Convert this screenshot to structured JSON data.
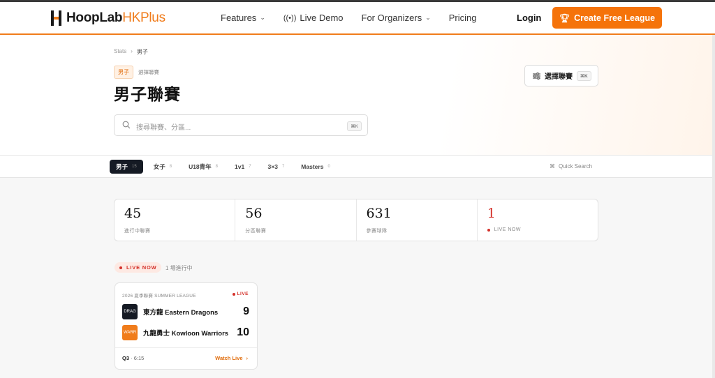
{
  "nav": {
    "logo_main": "HoopLab",
    "logo_accent": "HKPlus",
    "links": [
      {
        "label": "Features",
        "dropdown": true
      },
      {
        "label": "Live Demo",
        "icon": "radio-signal-icon"
      },
      {
        "label": "For Organizers",
        "dropdown": true
      },
      {
        "label": "Pricing"
      }
    ],
    "login": "Login",
    "cta": "Create Free League",
    "accent_color": "#f07c1b"
  },
  "breadcrumb": {
    "root": "Stats",
    "separator": "›",
    "current": "男子"
  },
  "hero": {
    "tag": "男子",
    "tag_sub": "選擇聯賽",
    "title": "男子聯賽",
    "search_placeholder": "搜尋聯賽、分區...",
    "search_shortcut": "⌘K",
    "pick_label": "選擇聯賽",
    "pick_shortcut": "⌘K"
  },
  "tabs": [
    {
      "label": "男子",
      "count": "15",
      "active": true
    },
    {
      "label": "女子",
      "count": "8"
    },
    {
      "label": "U18青年",
      "count": "8"
    },
    {
      "label": "1v1",
      "count": "7"
    },
    {
      "label": "3×3",
      "count": "7"
    },
    {
      "label": "Masters",
      "count": "0"
    }
  ],
  "quick_search": {
    "icon": "⌘",
    "label": "Quick Search"
  },
  "stats": [
    {
      "value": "45",
      "label": "進行中聯賽"
    },
    {
      "value": "56",
      "label": "分區聯賽"
    },
    {
      "value": "631",
      "label": "參賽球隊"
    },
    {
      "value": "1",
      "label": "LIVE NOW",
      "live": true
    }
  ],
  "live_section": {
    "badge": "LIVE NOW",
    "count_text": "1 場進行中"
  },
  "game": {
    "league": "2026 夏季聯賽 SUMMER LEAGUE",
    "live_label": "LIVE",
    "home": {
      "abbr": "DRAG",
      "name": "東方龍 Eastern Dragons",
      "score": "9"
    },
    "away": {
      "abbr": "WARR",
      "name": "九龍勇士 Kowloon Warriors",
      "score": "10"
    },
    "period": "Q3",
    "clock": "6:15",
    "watch": "Watch Live",
    "arrow": "›"
  }
}
